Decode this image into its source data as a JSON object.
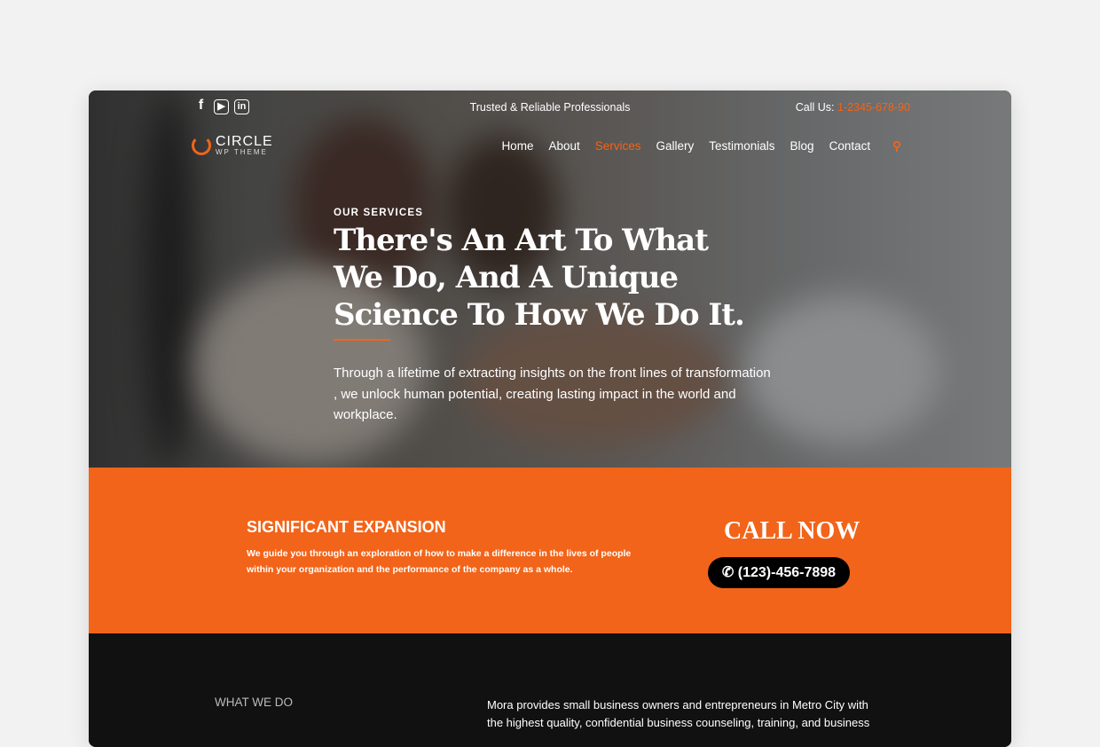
{
  "colors": {
    "accent": "#f26419",
    "dark": "#111111"
  },
  "topbar": {
    "social": [
      "facebook-icon",
      "youtube-icon",
      "linkedin-icon"
    ],
    "tagline": "Trusted & Reliable Professionals",
    "call_label": "Call Us:",
    "call_number": "1-2345-678-90"
  },
  "logo": {
    "name": "CIRCLE",
    "sub": "WP THEME"
  },
  "nav": {
    "items": [
      "Home",
      "About",
      "Services",
      "Gallery",
      "Testimonials",
      "Blog",
      "Contact"
    ],
    "active": "Services"
  },
  "hero": {
    "eyebrow": "OUR SERVICES",
    "title": "There's An Art To What We Do, And A Unique Science To How We Do It.",
    "lead": "Through a lifetime of extracting insights on the front lines of transformation , we unlock human potential, creating lasting impact in the world and workplace."
  },
  "band": {
    "title": "SIGNIFICANT EXPANSION",
    "text": "We guide you through an exploration of how to make a difference in the lives of people within your organization and the performance of the company as a whole.",
    "call_now": "CALL NOW",
    "phone": "(123)-456-7898"
  },
  "about": {
    "label": "WHAT WE DO",
    "text": "Mora provides small business owners and entrepreneurs in Metro City with the highest quality, confidential business counseling, training, and business"
  }
}
